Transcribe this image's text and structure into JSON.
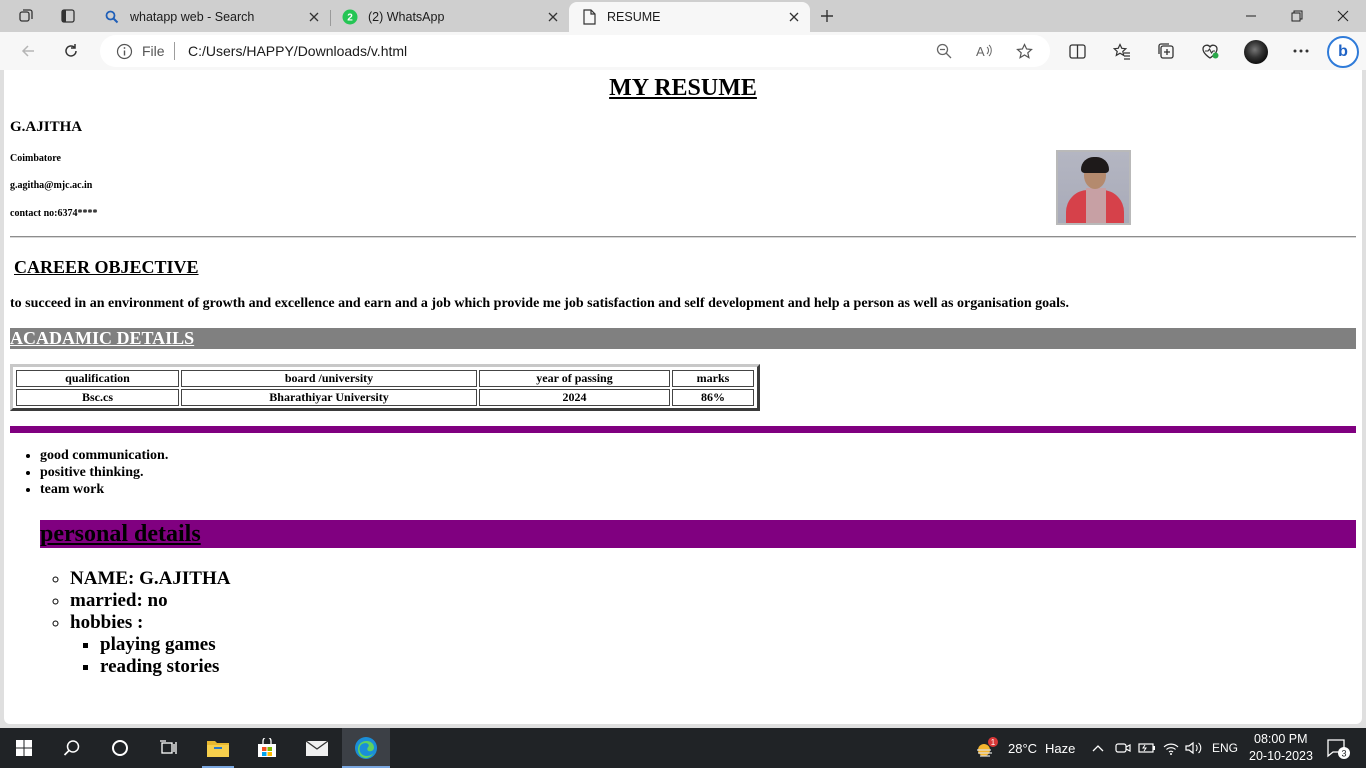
{
  "browser": {
    "tabs": [
      {
        "title": "whatapp web - Search",
        "icon": "search-icon"
      },
      {
        "title": "(2) WhatsApp",
        "icon": "whatsapp-icon",
        "badge": "2"
      },
      {
        "title": "RESUME",
        "icon": "document-icon",
        "active": true
      }
    ],
    "address": {
      "scheme_label": "File",
      "url": "C:/Users/HAPPY/Downloads/v.html"
    }
  },
  "resume": {
    "title": "MY RESUME",
    "name": "G.AJITHA",
    "city": "Coimbatore",
    "email": "g.agitha@mjc.ac.in",
    "contact": "contact no:6374****",
    "career_heading": "CAREER OBJECTIVE",
    "career_text": "to succeed in an environment of growth and excellence and earn and a job which provide me job satisfaction and self development and help a person as well as organisation goals.",
    "academic_heading": "ACADAMIC DETAILS",
    "table": {
      "headers": [
        "qualification",
        "board /university",
        "year of passing",
        "marks"
      ],
      "rows": [
        [
          "Bsc.cs",
          "Bharathiyar University",
          "2024",
          "86%"
        ]
      ]
    },
    "skills": [
      "good communication.",
      "positive thinking.",
      "team work"
    ],
    "personal_heading": "personal details",
    "personal": [
      "NAME: G.AJITHA",
      "married: no",
      "hobbies :"
    ],
    "hobbies": [
      "playing games",
      "reading stories"
    ]
  },
  "taskbar": {
    "weather_temp": "28°C",
    "weather_desc": "Haze",
    "weather_badge": "1",
    "language": "ENG",
    "time": "08:00 PM",
    "date": "20-10-2023",
    "notifications": "3"
  },
  "colors": {
    "purple": "#800080",
    "grey_bar": "#808080",
    "accent": "#2f7bd9"
  }
}
